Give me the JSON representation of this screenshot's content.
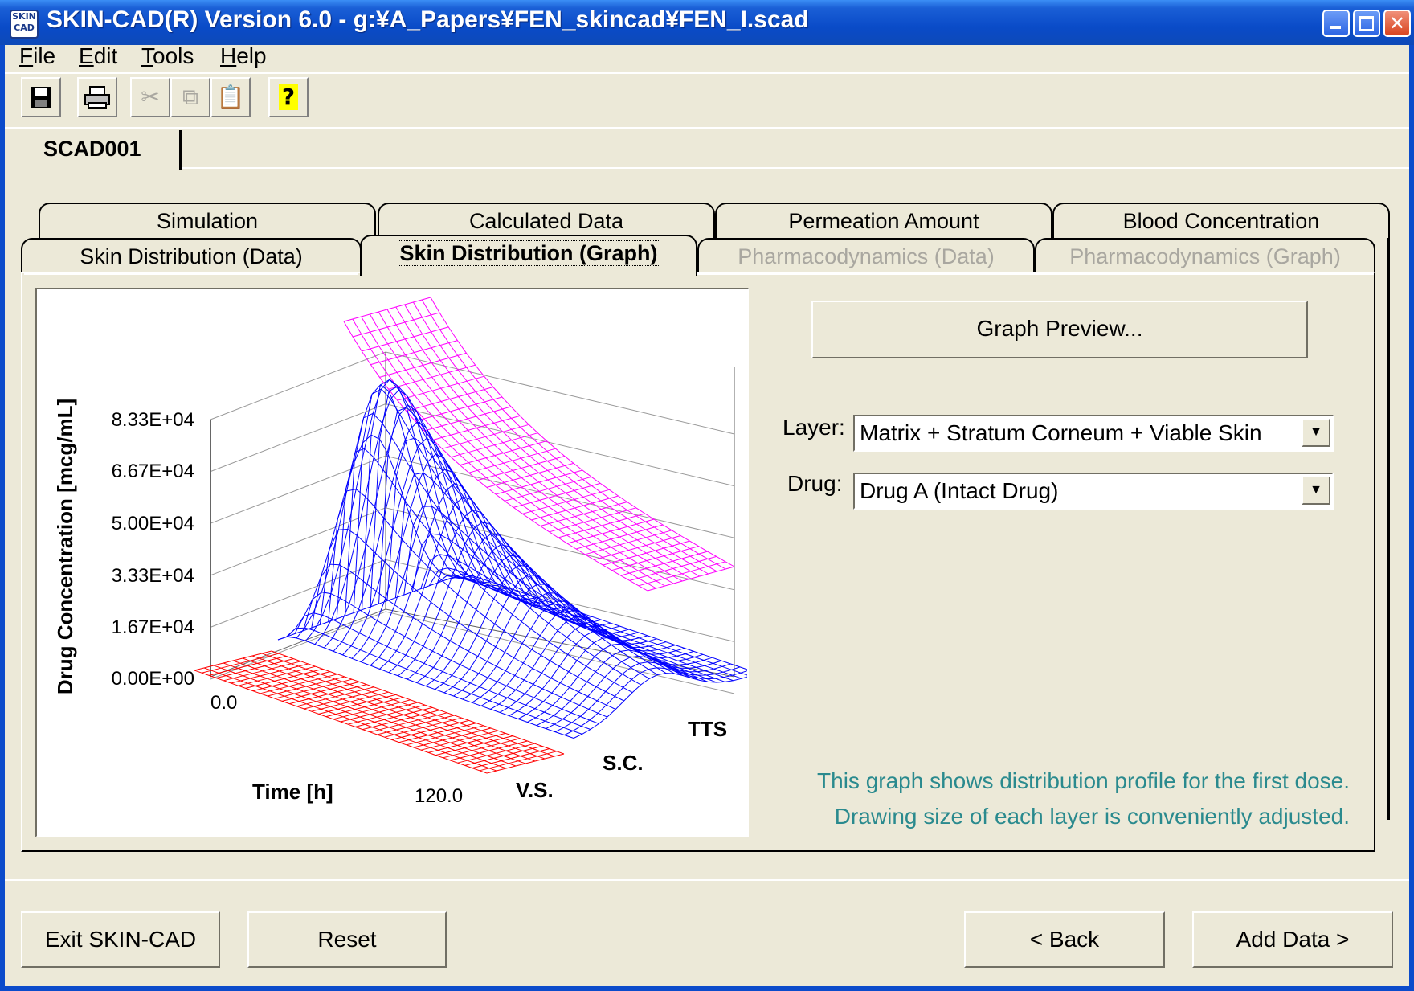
{
  "window": {
    "title": "SKIN-CAD(R) Version 6.0 - g:¥A_Papers¥FEN_skincad¥FEN_I.scad",
    "icon_label": "SKIN CAD"
  },
  "menu": [
    {
      "label": "File",
      "key": "F"
    },
    {
      "label": "Edit",
      "key": "E"
    },
    {
      "label": "Tools",
      "key": "T"
    },
    {
      "label": "Help",
      "key": "H"
    }
  ],
  "toolbar": {
    "icons": [
      "save-icon",
      "print-icon",
      "cut-icon",
      "copy-icon",
      "paste-icon",
      "help-icon"
    ]
  },
  "doc_tab": {
    "label": "SCAD001"
  },
  "tabs_row1": [
    "Simulation",
    "Calculated Data",
    "Permeation Amount",
    "Blood Concentration"
  ],
  "tabs_row2": [
    "Skin Distribution (Data)",
    "Skin Distribution (Graph)",
    "Pharmacodynamics (Data)",
    "Pharmacodynamics (Graph)"
  ],
  "selected_tab": "Skin Distribution (Graph)",
  "disabled_tabs": [
    "Pharmacodynamics (Data)",
    "Pharmacodynamics (Graph)"
  ],
  "graph": {
    "ylabel": "Drug Concentration [mcg/mL]",
    "yticks": [
      "8.33E+04",
      "6.67E+04",
      "5.00E+04",
      "3.33E+04",
      "1.67E+04",
      "0.00E+00"
    ],
    "time_start": "0.0",
    "time_end": "120.0",
    "time_label": "Time [h]",
    "layer_labels": [
      "TTS",
      "S.C.",
      "V.S."
    ],
    "colors": {
      "TTS": "#ff00ff",
      "SC": "#0000ff",
      "VS": "#ff0000"
    }
  },
  "controls": {
    "preview_button": "Graph Preview...",
    "layer_label": "Layer:",
    "layer_value": "Matrix + Stratum Corneum + Viable Skin",
    "drug_label": "Drug:",
    "drug_value": "Drug A (Intact Drug)"
  },
  "notes": [
    "This graph shows distribution profile for the first dose.",
    "Drawing size of each layer is conveniently adjusted."
  ],
  "footer": {
    "exit": "Exit SKIN-CAD",
    "reset": "Reset",
    "back": "< Back",
    "add": "Add Data >"
  }
}
